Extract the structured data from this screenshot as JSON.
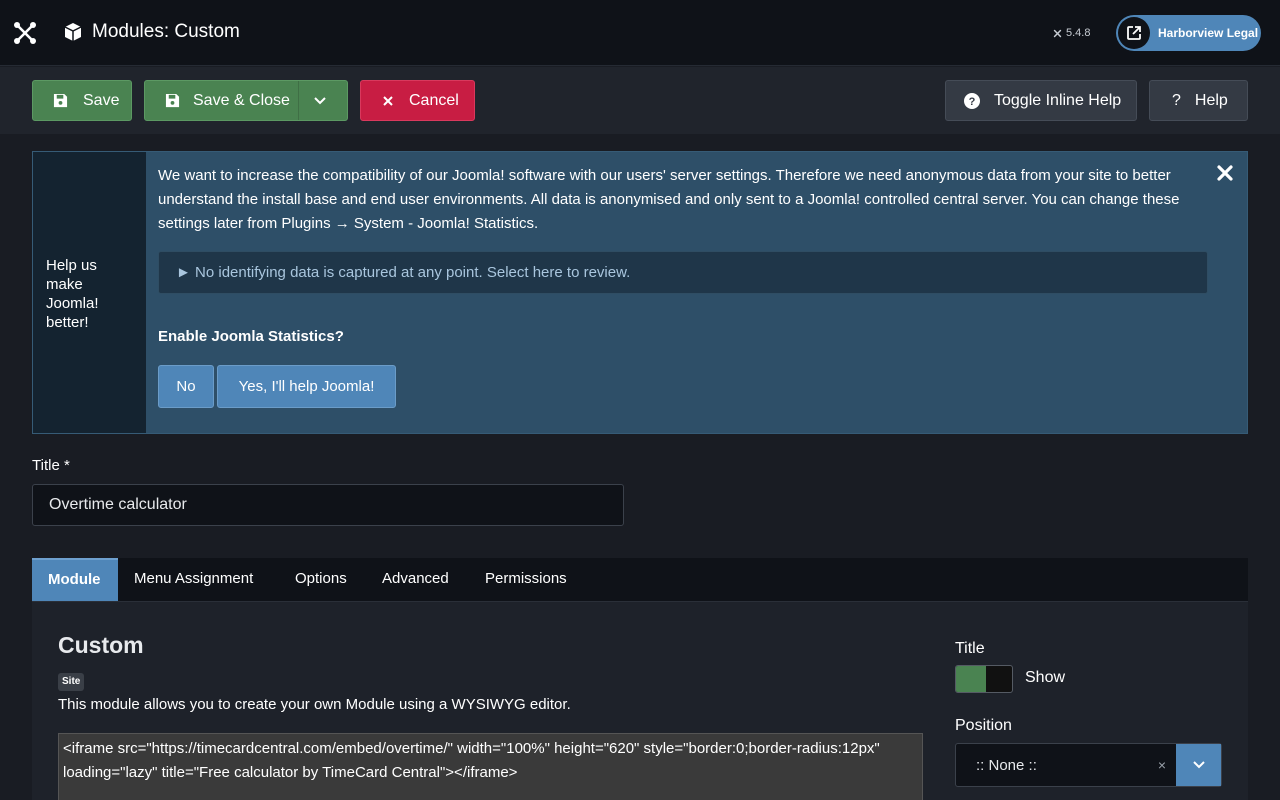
{
  "header": {
    "page_title": "Modules: Custom",
    "version": "5.4.8",
    "site_name": "Harborview Legal"
  },
  "toolbar": {
    "save_label": "Save",
    "save_close_label": "Save & Close",
    "cancel_label": "Cancel",
    "toggle_help_label": "Toggle Inline Help",
    "help_label": "Help"
  },
  "stats": {
    "side_text": "Help us make Joomla! better!",
    "message": "We want to increase the compatibility of our Joomla! software with our users' server settings. Therefore we need anonymous data from your site to better understand the install base and end user environments. All data is anonymised and only sent to a Joomla! controlled central server. You can change these settings later from Plugins → System - Joomla! Statistics.",
    "details_label": "► No identifying data is captured at any point. Select here to review.",
    "question": "Enable Joomla Statistics?",
    "no_label": "No",
    "yes_label": "Yes, I'll help Joomla!"
  },
  "title_field": {
    "label": "Title *",
    "value": "Overtime calculator"
  },
  "tabs": [
    {
      "label": "Module",
      "active": true
    },
    {
      "label": "Menu Assignment",
      "active": false
    },
    {
      "label": "Options",
      "active": false
    },
    {
      "label": "Advanced",
      "active": false
    },
    {
      "label": "Permissions",
      "active": false
    }
  ],
  "module": {
    "heading": "Custom",
    "badge": "Site",
    "description": "This module allows you to create your own Module using a WYSIWYG editor.",
    "editor_content": "<iframe src=\"https://timecardcentral.com/embed/overtime/\" width=\"100%\" height=\"620\" style=\"border:0;border-radius:12px\" loading=\"lazy\" title=\"Free calculator by TimeCard Central\"></iframe>"
  },
  "sidebar": {
    "title_label": "Title",
    "show_label": "Show",
    "show_enabled": true,
    "position_label": "Position",
    "position_value": ":: None ::",
    "clear_symbol": "×"
  },
  "colors": {
    "accent": "#4f86b8",
    "success": "#4a8351",
    "danger": "#c81d43"
  },
  "icons": [
    "joomla-logo-icon",
    "cube-icon",
    "external-link-icon",
    "save-icon",
    "chevron-down-icon",
    "close-icon",
    "question-circle-icon",
    "question-icon"
  ]
}
